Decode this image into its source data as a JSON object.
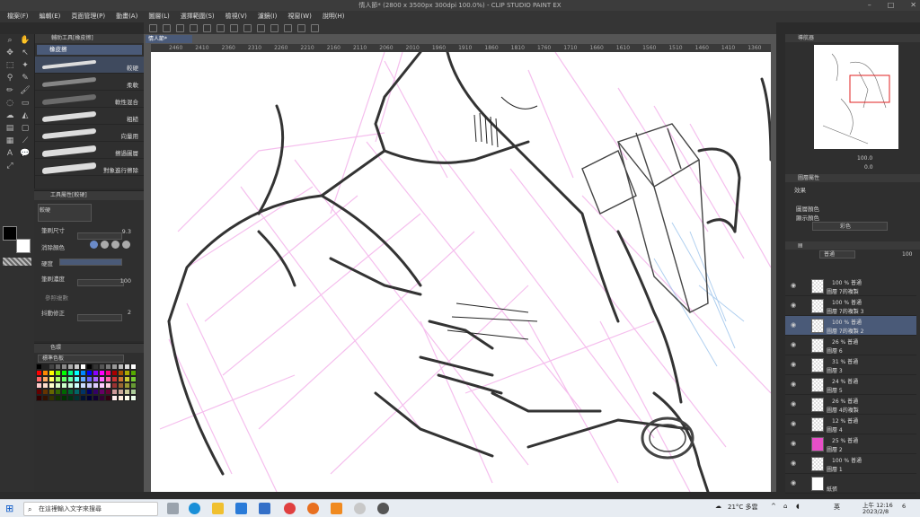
{
  "window": {
    "title": "情人節* (2800 x 3500px 300dpi 100.0%) - CLIP STUDIO PAINT EX"
  },
  "menu": [
    "檔案(F)",
    "編輯(E)",
    "頁面管理(P)",
    "動畫(A)",
    "圖層(L)",
    "選擇範圍(S)",
    "檢視(V)",
    "濾鏡(I)",
    "視窗(W)",
    "說明(H)"
  ],
  "subtool": {
    "tab_label": "輔助工具[橡皮擦]",
    "group_label": "橡皮擦",
    "brushes": [
      "較硬",
      "柔軟",
      "軟性混合",
      "粗糙",
      "向量用",
      "擦過圖層",
      "對象進行擦除"
    ]
  },
  "tool_property": {
    "tab_label": "工具屬性[較硬]",
    "name": "較硬",
    "brush_size_label": "筆刷尺寸",
    "brush_size_value": "9.3",
    "erase_mode_label": "消除顏色",
    "hardness_label": "硬度",
    "density_label": "筆刷濃度",
    "density_value": "100",
    "reference_label": "參照複數",
    "stabilize_label": "抖動修正",
    "stabilize_value": "2"
  },
  "colorset": {
    "tab_label": "色環",
    "set_name": "標準色板"
  },
  "canvas": {
    "tab_label": "情人節*",
    "ruler_marks": [
      "2460",
      "2410",
      "2360",
      "2310",
      "2260",
      "2210",
      "2160",
      "2110",
      "2060",
      "2010",
      "1960",
      "1910",
      "1860",
      "1810",
      "1760",
      "1710",
      "1660",
      "1610",
      "1560",
      "1510",
      "1460",
      "1410",
      "1360"
    ]
  },
  "navigator": {
    "tab_label": "導航器",
    "zoom": "100.0",
    "angle": "0.0"
  },
  "layer_property": {
    "tab_label": "圖層屬性",
    "effect_label": "效果",
    "layer_color_label": "圖層顏色",
    "display_color_label": "顯示顏色",
    "display_color_value": "彩色"
  },
  "layers_panel": {
    "blend_mode": "普通",
    "opacity": "100"
  },
  "layers": [
    {
      "mode": "100 % 普通",
      "name": "圖層 7的複製",
      "thumb": "trans",
      "selected": false
    },
    {
      "mode": "100 % 普通",
      "name": "圖層 7的複製 3",
      "thumb": "trans",
      "selected": false
    },
    {
      "mode": "100 % 普通",
      "name": "圖層 7的複製 2",
      "thumb": "trans",
      "selected": true
    },
    {
      "mode": "26 % 普通",
      "name": "圖層 6",
      "thumb": "trans",
      "selected": false
    },
    {
      "mode": "31 % 普通",
      "name": "圖層 3",
      "thumb": "trans",
      "selected": false
    },
    {
      "mode": "24 % 普通",
      "name": "圖層 5",
      "thumb": "trans",
      "selected": false
    },
    {
      "mode": "26 % 普通",
      "name": "圖層 4的複製",
      "thumb": "trans",
      "selected": false
    },
    {
      "mode": "12 % 普通",
      "name": "圖層 4",
      "thumb": "trans",
      "selected": false
    },
    {
      "mode": "25 % 普通",
      "name": "圖層 2",
      "thumb": "pink",
      "selected": false
    },
    {
      "mode": "100 % 普通",
      "name": "圖層 1",
      "thumb": "trans",
      "selected": false
    },
    {
      "mode": "",
      "name": "紙張",
      "thumb": "white",
      "selected": false
    }
  ],
  "taskbar": {
    "search_placeholder": "在這裡輸入文字來搜尋",
    "weather": "21°C 多雲",
    "ime": "英",
    "time": "上午 12:16",
    "date": "2023/2/8",
    "notifications": "6"
  },
  "colors": {
    "accent": "#4a5a78",
    "panel": "#2f2f2f",
    "sketch_pink": "#f4b8ec"
  }
}
